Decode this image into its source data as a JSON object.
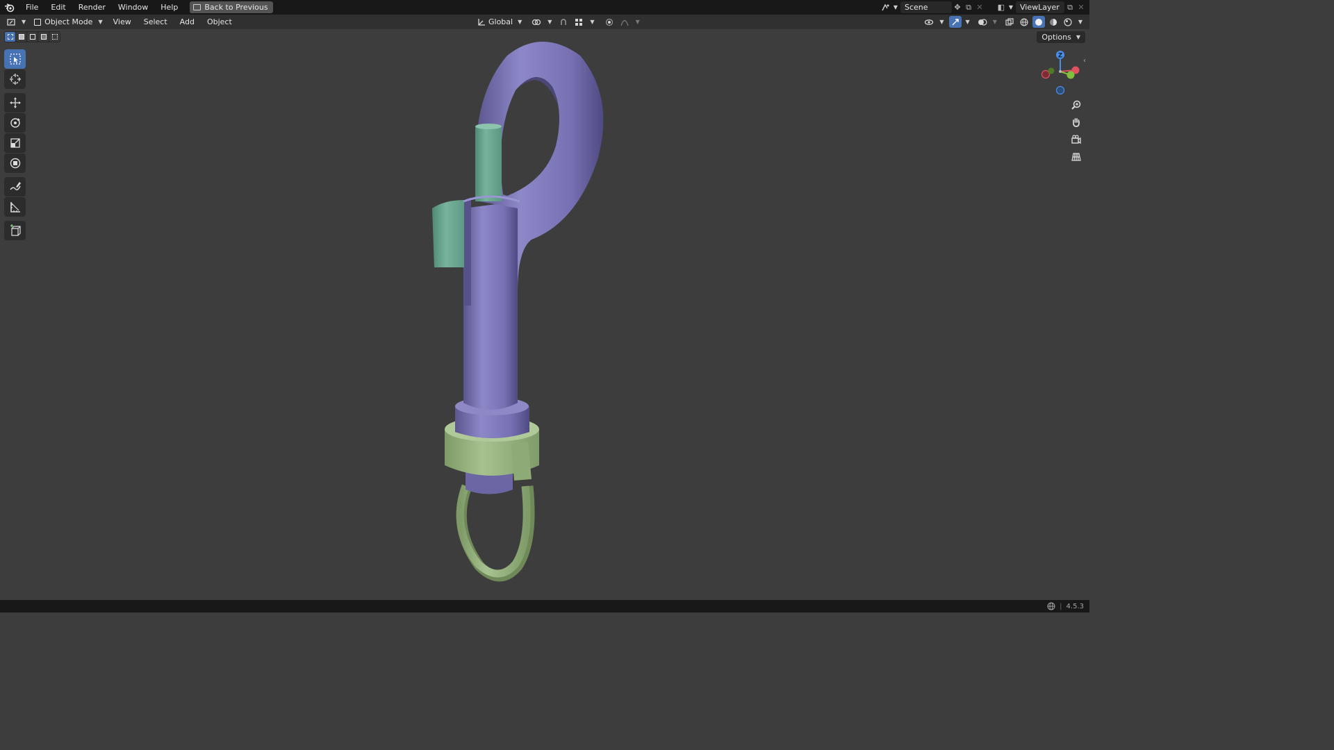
{
  "topbar": {
    "menus": [
      "File",
      "Edit",
      "Render",
      "Window",
      "Help"
    ],
    "back_button": "Back to Previous",
    "scene_name": "Scene",
    "view_layer": "ViewLayer"
  },
  "header": {
    "mode": "Object Mode",
    "menus": [
      "View",
      "Select",
      "Add",
      "Object"
    ],
    "transform_orientation": "Global"
  },
  "options_label": "Options",
  "gizmo": {
    "z_label": "Z"
  },
  "status": {
    "version": "4.5.3"
  },
  "colors": {
    "accent": "#4772b3",
    "model_purple": "#7c76b8",
    "model_teal": "#6fa893",
    "model_green": "#96b27e",
    "viewport_bg": "#3d3d3d"
  },
  "toolbar_tools": [
    "select-box",
    "cursor",
    "move",
    "rotate",
    "scale",
    "transform",
    "annotate",
    "measure",
    "add-cube"
  ]
}
